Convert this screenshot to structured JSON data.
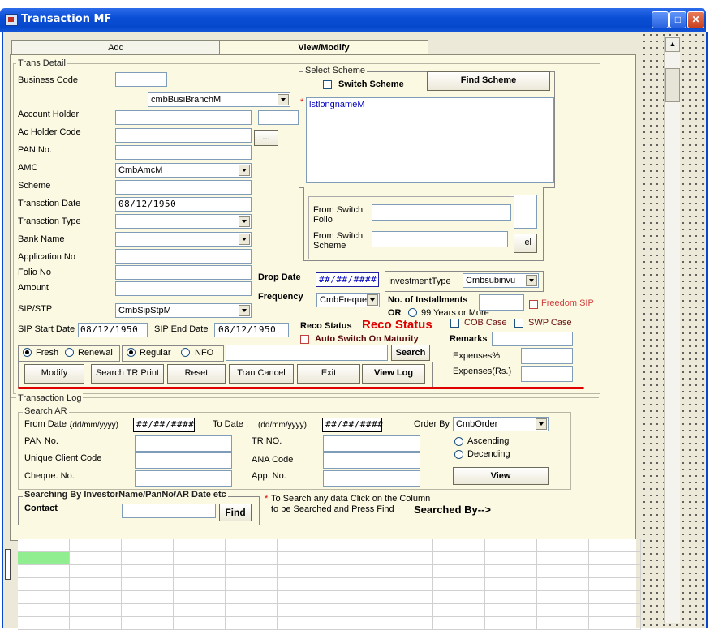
{
  "window": {
    "title": "Transaction MF",
    "min": "_",
    "max": "□",
    "close": "✕"
  },
  "tabs": [
    {
      "label": "Add"
    },
    {
      "label": "View/Modify"
    }
  ],
  "trans_detail": {
    "frame_label": "Trans Detail",
    "business_code": "Business Code",
    "branch_combo": "cmbBusiBranchM",
    "account_holder": "Account Holder",
    "ac_holder_code": "Ac Holder Code",
    "ellipsis": "...",
    "pan": "PAN No.",
    "amc": "AMC",
    "amc_combo": "CmbAmcM",
    "scheme": "Scheme",
    "trans_date": "Transction Date",
    "trans_date_value": "08/12/1950",
    "trans_type": "Transction Type",
    "bank": "Bank Name",
    "application": "Application No",
    "folio": "Folio No",
    "amount": "Amount",
    "sip_stp": "SIP/STP",
    "sip_combo": "CmbSipStpM",
    "sip_start": "SIP Start Date",
    "sip_start_value": "08/12/1950",
    "sip_end": "SIP End Date",
    "sip_end_value": "08/12/1950"
  },
  "select_scheme": {
    "frame_label": "Select Scheme",
    "switch_scheme": "Switch Scheme",
    "find_scheme": "Find Scheme",
    "list_item": "lstlongnameM",
    "star": "*",
    "from_switch_folio": "From Switch Folio",
    "from_switch_scheme": "From Switch Scheme",
    "partial_btn": "el"
  },
  "middle": {
    "drop_date": "Drop Date",
    "drop_date_value": "##/##/####",
    "investment_type": "InvestmentType",
    "investment_combo": "Cmbsubinvu",
    "frequency": "Frequency",
    "frequency_combo": "CmbFrequer",
    "no_installments": "No. of Installments",
    "or": "OR",
    "years_99": "99 Years or More",
    "freedom_sip": "Freedom SIP",
    "reco_status": "Reco Status",
    "reco_status_value": "Reco Status",
    "cob_case": "COB Case",
    "swp_case": "SWP Case",
    "auto_switch": "Auto Switch On Maturity",
    "remarks": "Remarks",
    "expenses_pct": "Expenses%",
    "expenses_rs": "Expenses(Rs.)"
  },
  "options": {
    "fresh": "Fresh",
    "renewal": "Renewal",
    "regular": "Regular",
    "nfo": "NFO",
    "search": "Search"
  },
  "buttons": {
    "modify": "Modify",
    "search_tr_print": "Search TR Print",
    "reset": "Reset",
    "tran_cancel": "Tran Cancel",
    "exit": "Exit",
    "view_log": "View Log"
  },
  "transaction_log": {
    "frame_label": "Transaction Log",
    "search_ar": "Search AR",
    "from_date": "From Date :",
    "from_fmt": "(dd/mm/yyyy)",
    "from_value": "##/##/####",
    "to_date": "To Date :",
    "to_fmt": "(dd/mm/yyyy)",
    "to_value": "##/##/####",
    "order_by": "Order By",
    "order_combo": "CmbOrder",
    "pan": "PAN No.",
    "tr_no": "TR NO.",
    "ascending": "Ascending",
    "descending": "Decending",
    "ucc": "Unique Client Code",
    "ana": "ANA Code",
    "cheque": "Cheque. No.",
    "app_no": "App. No.",
    "view": "View"
  },
  "investor_search": {
    "frame_label": "Searching By InvestorName/PanNo/AR Date etc",
    "contact": "Contact",
    "find": "Find",
    "hint_star": "*",
    "hint_line1": "To Search any data Click on the Column",
    "hint_line2": "to be Searched and Press Find",
    "searched_by": "Searched By-->"
  },
  "colors": {
    "title_bar": "#0a4fd6",
    "form_bg": "#fbf9e2",
    "reco_red": "#e00000",
    "accent_line": "#e00000",
    "grid_selected": "#90ee90"
  }
}
